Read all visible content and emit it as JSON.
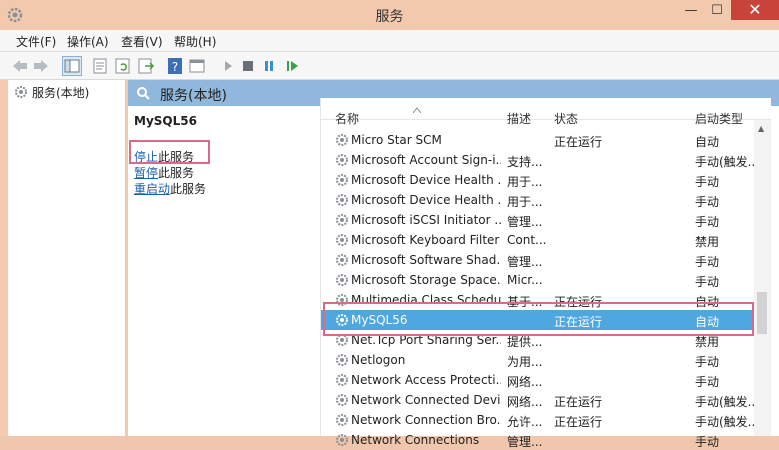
{
  "window": {
    "title": "服务"
  },
  "menu": [
    "文件(F)",
    "操作(A)",
    "查看(V)",
    "帮助(H)"
  ],
  "toolbar_icons": [
    "back-arrow-icon",
    "forward-arrow-icon",
    "console-tree-icon",
    "properties-icon",
    "refresh-icon",
    "export-list-icon",
    "help-icon",
    "view-icon",
    "start-service-icon",
    "stop-service-icon",
    "pause-service-icon",
    "resume-service-icon"
  ],
  "tree": {
    "root_label": "服务(本地)"
  },
  "panel": {
    "title": "服务(本地)",
    "service_name": "MySQL56",
    "actions": [
      {
        "link": "停止",
        "rest": "此服务"
      },
      {
        "link": "暂停",
        "rest": "此服务"
      },
      {
        "link": "重启动",
        "rest": "此服务"
      }
    ]
  },
  "columns": {
    "name": "名称",
    "desc": "描述",
    "status": "状态",
    "start": "启动类型"
  },
  "services": [
    {
      "name": "Micro Star SCM",
      "desc": "",
      "status": "正在运行",
      "start": "自动"
    },
    {
      "name": "Microsoft Account Sign-i...",
      "desc": "支持...",
      "status": "",
      "start": "手动(触发..."
    },
    {
      "name": "Microsoft Device Health ...",
      "desc": "用于...",
      "status": "",
      "start": "手动"
    },
    {
      "name": "Microsoft Device Health ...",
      "desc": "用于...",
      "status": "",
      "start": "手动"
    },
    {
      "name": "Microsoft iSCSI Initiator ...",
      "desc": "管理...",
      "status": "",
      "start": "手动"
    },
    {
      "name": "Microsoft Keyboard Filter",
      "desc": "Cont...",
      "status": "",
      "start": "禁用"
    },
    {
      "name": "Microsoft Software Shad...",
      "desc": "管理...",
      "status": "",
      "start": "手动"
    },
    {
      "name": "Microsoft Storage Space...",
      "desc": "Micr...",
      "status": "",
      "start": "手动"
    },
    {
      "name": "Multimedia Class Schedu...",
      "desc": "基于...",
      "status": "正在运行",
      "start": "自动"
    },
    {
      "name": "MySQL56",
      "desc": "",
      "status": "正在运行",
      "start": "自动",
      "selected": true
    },
    {
      "name": "Net.Tcp Port Sharing Ser...",
      "desc": "提供...",
      "status": "",
      "start": "禁用"
    },
    {
      "name": "Netlogon",
      "desc": "为用...",
      "status": "",
      "start": "手动"
    },
    {
      "name": "Network Access Protecti...",
      "desc": "网络...",
      "status": "",
      "start": "手动"
    },
    {
      "name": "Network Connected Devi...",
      "desc": "网络...",
      "status": "正在运行",
      "start": "手动(触发..."
    },
    {
      "name": "Network Connection Bro...",
      "desc": "允许...",
      "status": "正在运行",
      "start": "手动(触发..."
    },
    {
      "name": "Network Connections",
      "desc": "管理...",
      "status": "",
      "start": "手动"
    }
  ],
  "colors": {
    "selection": "#4fa7df",
    "highlight_border": "#d96b86",
    "header": "#8fb8dc",
    "titlebar": "#f3c9ad",
    "close": "#c8433a"
  }
}
